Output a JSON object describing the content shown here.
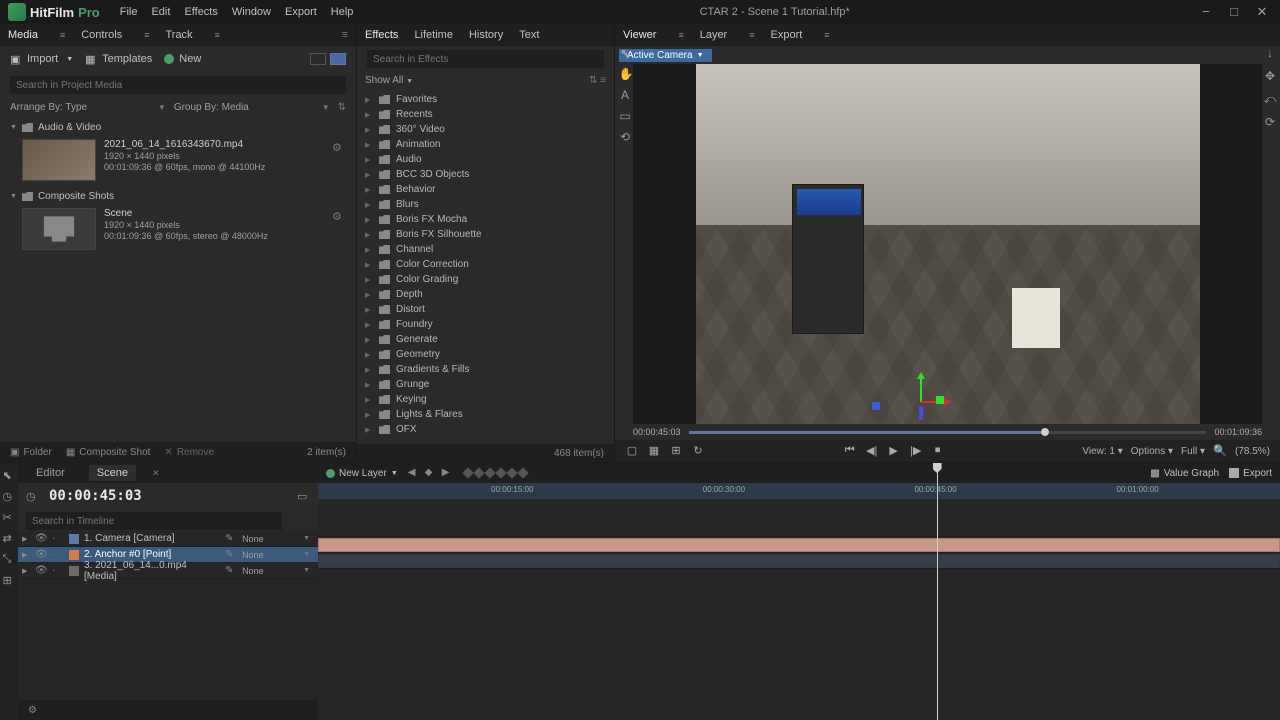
{
  "app": {
    "name": "HitFilm",
    "edition": "Pro",
    "title": "CTAR 2 - Scene 1 Tutorial.hfp*"
  },
  "menubar": [
    "File",
    "Edit",
    "Effects",
    "Window",
    "Export",
    "Help"
  ],
  "left_panel": {
    "tabs": [
      "Media",
      "Controls",
      "Track"
    ],
    "import_label": "Import",
    "templates_label": "Templates",
    "new_label": "New",
    "search_placeholder": "Search in Project Media",
    "arrange_label": "Arrange By:",
    "arrange_value": "Type",
    "group_label": "Group By:",
    "group_value": "Media",
    "groups": [
      {
        "name": "Audio & Video",
        "items": [
          {
            "name": "2021_06_14_1616343670.mp4",
            "res": "1920 × 1440 pixels",
            "meta": "00:01:09:36 @ 60fps, mono @ 44100Hz"
          }
        ]
      },
      {
        "name": "Composite Shots",
        "items": [
          {
            "name": "Scene",
            "res": "1920 × 1440 pixels",
            "meta": "00:01:09:36 @ 60fps, stereo @ 48000Hz"
          }
        ]
      }
    ]
  },
  "effects_panel": {
    "tabs": [
      "Effects",
      "Lifetime",
      "History",
      "Text"
    ],
    "search_placeholder": "Search in Effects",
    "show_all": "Show All",
    "categories": [
      "Favorites",
      "Recents",
      "360° Video",
      "Animation",
      "Audio",
      "BCC 3D Objects",
      "Behavior",
      "Blurs",
      "Boris FX Mocha",
      "Boris FX Silhouette",
      "Channel",
      "Color Correction",
      "Color Grading",
      "Depth",
      "Distort",
      "Foundry",
      "Generate",
      "Geometry",
      "Gradients & Fills",
      "Grunge",
      "Keying",
      "Lights & Flares",
      "OFX"
    ],
    "footer": "468 item(s)"
  },
  "viewer": {
    "tabs": [
      "Viewer",
      "Layer",
      "Export"
    ],
    "active_camera": "Active Camera",
    "time_current": "00:00:45:03",
    "time_total": "00:01:09:36",
    "view_label": "View: 1",
    "options_label": "Options",
    "full_label": "Full",
    "zoom": "(78.5%)"
  },
  "timeline": {
    "tabs": [
      "Editor",
      "Scene"
    ],
    "time": "00:00:45:03",
    "new_layer": "New Layer",
    "value_graph": "Value Graph",
    "export": "Export",
    "search_placeholder": "Search in Timeline",
    "ruler": [
      "00:00:15:00",
      "00:00:30:00",
      "00:00:45:00",
      "00:01:00:00"
    ],
    "layers": [
      {
        "name": "1. Camera [Camera]",
        "parent": "None"
      },
      {
        "name": "2. Anchor #0 [Point]",
        "parent": "None"
      },
      {
        "name": "3. 2021_06_14...0.mp4 [Media]",
        "parent": "None"
      }
    ]
  },
  "footer": {
    "folder": "Folder",
    "composite": "Composite Shot",
    "remove": "Remove",
    "items": "2 item(s)"
  }
}
